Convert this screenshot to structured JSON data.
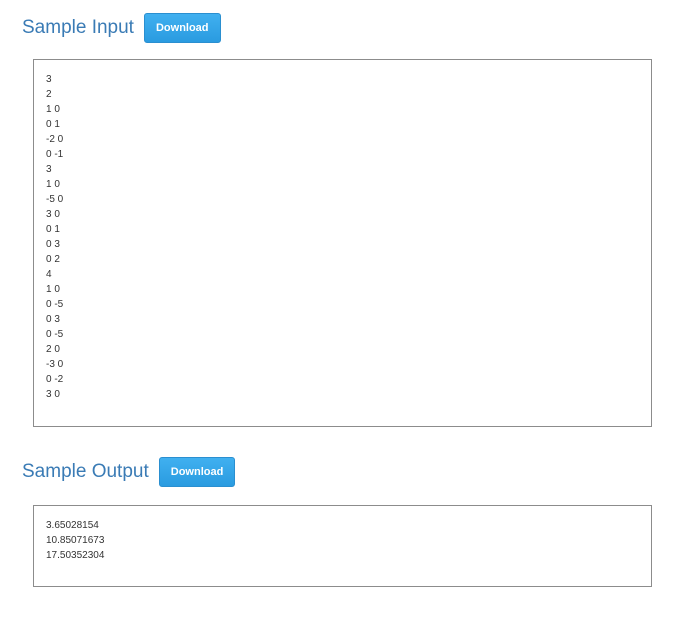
{
  "sample_input": {
    "title": "Sample Input",
    "download_label": "Download",
    "lines": [
      "3",
      "2",
      "1 0",
      "0 1",
      "-2 0",
      "0 -1",
      "3",
      "1 0",
      "-5 0",
      "3 0",
      "0 1",
      "0 3",
      "0 2",
      "4",
      "1 0",
      "0 -5",
      "0 3",
      "0 -5",
      "2 0",
      "-3 0",
      "0 -2",
      "3 0"
    ]
  },
  "sample_output": {
    "title": "Sample Output",
    "download_label": "Download",
    "lines": [
      "3.65028154",
      "10.85071673",
      "17.50352304"
    ]
  }
}
